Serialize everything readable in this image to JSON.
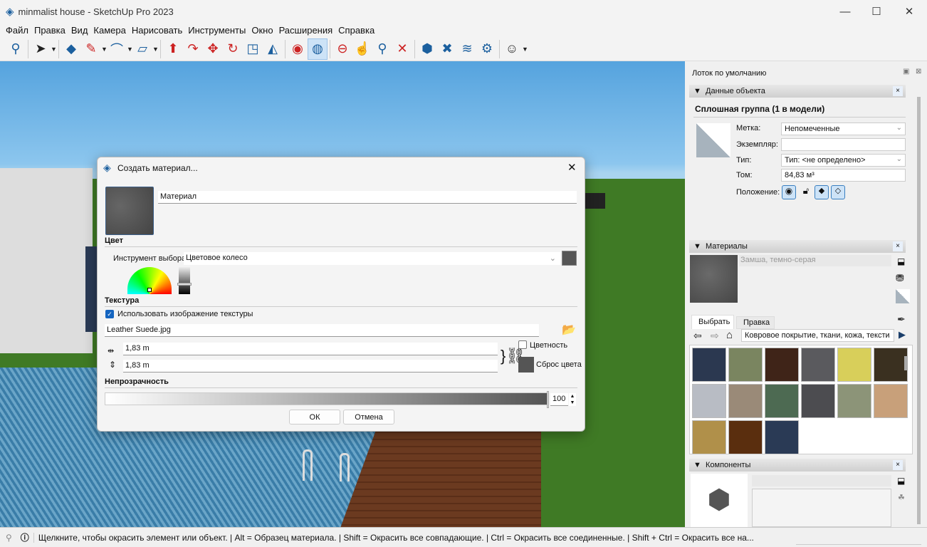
{
  "window": {
    "title": "minmalist house - SketchUp Pro 2023",
    "minimize": "—",
    "maximize": "☐",
    "close": "✕"
  },
  "menu": [
    "Файл",
    "Правка",
    "Вид",
    "Камера",
    "Нарисовать",
    "Инструменты",
    "Окно",
    "Расширения",
    "Справка"
  ],
  "toolbar": {
    "icons": [
      "search-icon",
      "select-icon",
      "eraser-icon",
      "pencil-icon",
      "arc-icon",
      "rectangle-icon",
      "push-pull-icon",
      "follow-me-icon",
      "move-icon",
      "rotate-icon",
      "scale-icon",
      "flip-icon",
      "tape-icon",
      "paint-bucket-icon",
      "orbit-icon",
      "pan-icon",
      "zoom-icon",
      "zoom-extents-icon",
      "warehouse-icon",
      "extension-icon",
      "layers-icon",
      "settings-icon",
      "account-icon"
    ]
  },
  "dialog": {
    "title": "Создать материал...",
    "close": "✕",
    "name_value": "Материал",
    "color_heading": "Цвет",
    "picker_label": "Инструмент выбора:",
    "picker_value": "Цветовое колесо",
    "texture_heading": "Текстура",
    "use_texture_label": "Использовать изображение текстуры",
    "use_texture_checked": true,
    "texture_file": "Leather Suede.jpg",
    "width_value": "1,83 m",
    "height_value": "1,83 m",
    "colorize_label": "Цветность",
    "colorize_checked": false,
    "reset_color_label": "Сброс цвета",
    "opacity_heading": "Непрозрачность",
    "opacity_value": "100",
    "opacity_percent": 100,
    "ok": "ОК",
    "cancel": "Отмена",
    "swatch_color": "#555555"
  },
  "tray": {
    "title": "Лоток по умолчанию",
    "entity_info": {
      "header": "Данные объекта",
      "close": "×",
      "object": "Сплошная группа (1 в модели)",
      "tag_label": "Метка:",
      "tag_value": "Непомеченные",
      "instance_label": "Экземпляр:",
      "instance_value": "",
      "type_label": "Тип:",
      "type_value": "Тип: <не определено>",
      "volume_label": "Том:",
      "volume_value": "84,83 м³",
      "position_label": "Положение:"
    },
    "materials": {
      "header": "Материалы",
      "close": "×",
      "current": "Замша, темно-серая",
      "tab_select": "Выбрать",
      "tab_edit": "Правка",
      "library": "Ковровое покрытие, ткани, кожа, тексти",
      "swatches": [
        "#2b3850",
        "#7a8560",
        "#3f2418",
        "#5a5a5e",
        "#d8cf5a",
        "#3a3020",
        "#b8bcc4",
        "#9a8a78",
        "#4d6a52",
        "#4c4c50",
        "#8c9478",
        "#c8a07a",
        "#b0904a",
        "#5a2e0e",
        "#2a3a55"
      ]
    },
    "components": {
      "header": "Компоненты",
      "close": "×"
    }
  },
  "status": {
    "text": "Щелкните, чтобы окрасить элемент или объект. | Alt = Образец материала. | Shift = Окрасить все совпадающие. | Ctrl = Окрасить все соединенные. | Shift + Ctrl = Окрасить все на..."
  }
}
